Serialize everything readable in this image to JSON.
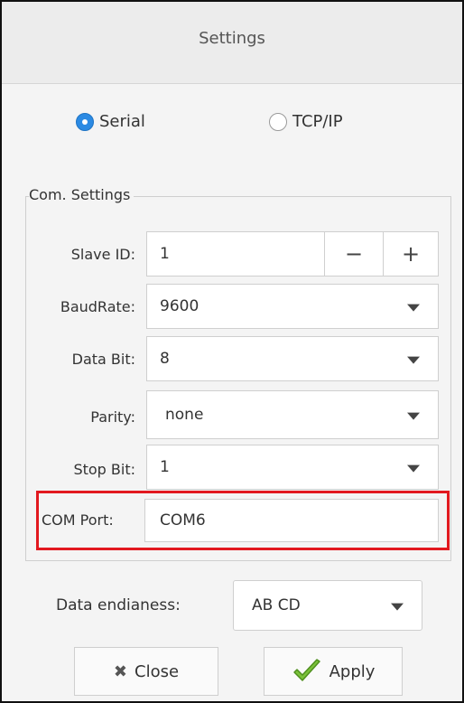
{
  "window": {
    "title": "Settings"
  },
  "connection": {
    "serial_label": "Serial",
    "tcp_label": "TCP/IP",
    "selected": "Serial"
  },
  "com_settings": {
    "group_title": "Com. Settings",
    "slave_id": {
      "label": "Slave ID:",
      "value": "1",
      "minus": "−",
      "plus": "+"
    },
    "baud_rate": {
      "label": "BaudRate:",
      "value": "9600"
    },
    "data_bit": {
      "label": "Data Bit:",
      "value": "8"
    },
    "parity": {
      "label": "Parity:",
      "value": "none"
    },
    "stop_bit": {
      "label": "Stop Bit:",
      "value": "1"
    },
    "com_port": {
      "label": "COM Port:",
      "value": "COM6"
    }
  },
  "endianness": {
    "label": "Data endianess:",
    "value": "AB CD"
  },
  "buttons": {
    "close_label": "Close",
    "apply_label": "Apply"
  },
  "colors": {
    "accent": "#2b8ae3",
    "highlight_border": "#e2191f",
    "apply_check": "#7bc23a"
  }
}
